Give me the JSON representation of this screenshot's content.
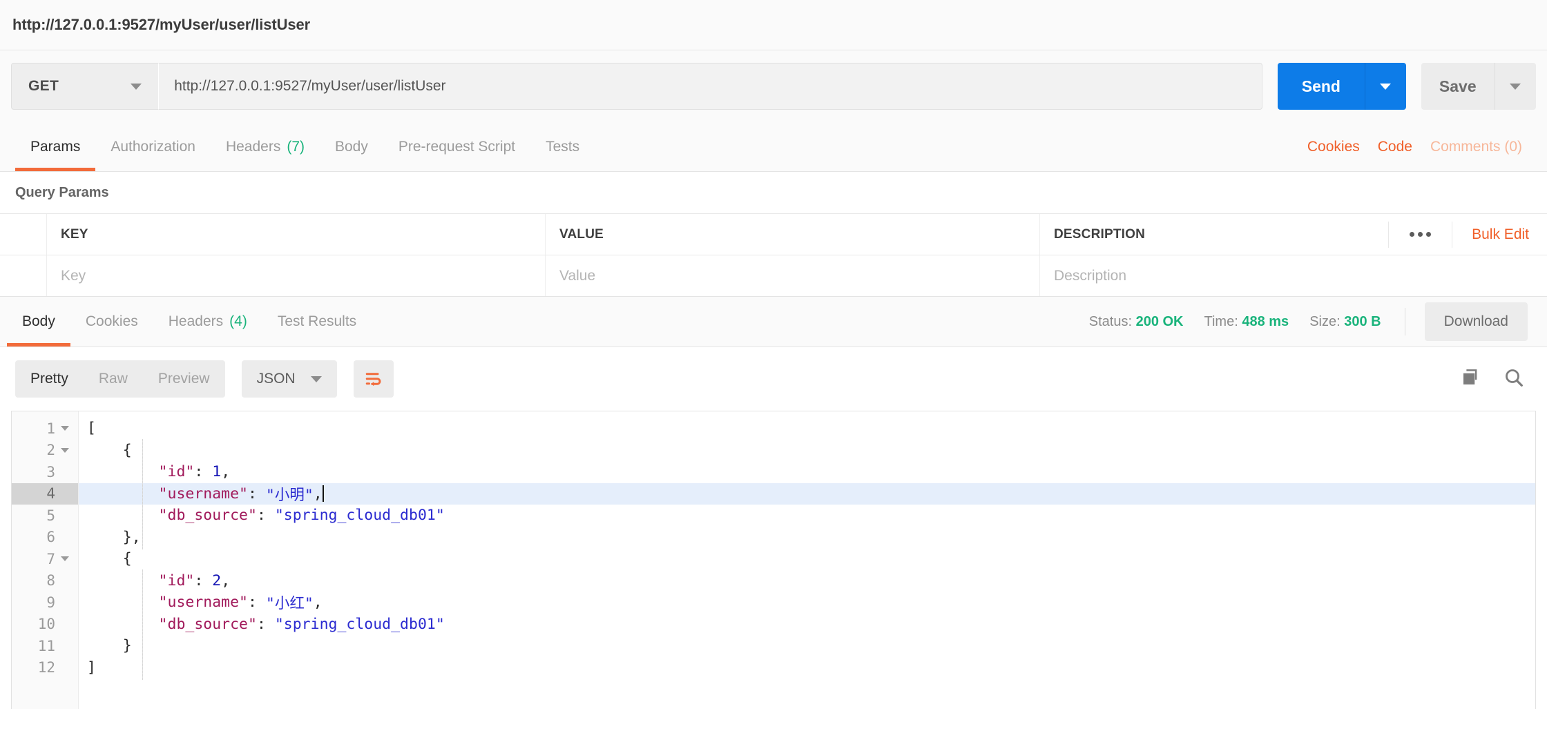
{
  "request_title": "http://127.0.0.1:9527/myUser/user/listUser",
  "url_bar": {
    "method": "GET",
    "url_value": "http://127.0.0.1:9527/myUser/user/listUser",
    "send_label": "Send",
    "save_label": "Save"
  },
  "request_tabs": {
    "items": [
      {
        "label": "Params",
        "badge": "",
        "active": true
      },
      {
        "label": "Authorization",
        "badge": "",
        "active": false
      },
      {
        "label": "Headers",
        "badge": "(7)",
        "active": false
      },
      {
        "label": "Body",
        "badge": "",
        "active": false
      },
      {
        "label": "Pre-request Script",
        "badge": "",
        "active": false
      },
      {
        "label": "Tests",
        "badge": "",
        "active": false
      }
    ],
    "cookies_label": "Cookies",
    "code_label": "Code",
    "comments_label": "Comments (0)"
  },
  "query_params": {
    "section_title": "Query Params",
    "columns": [
      "KEY",
      "VALUE",
      "DESCRIPTION"
    ],
    "placeholder_row": {
      "key": "Key",
      "value": "Value",
      "description": "Description"
    },
    "bulk_edit_label": "Bulk Edit"
  },
  "response_tabs": {
    "items": [
      {
        "label": "Body",
        "badge": "",
        "active": true
      },
      {
        "label": "Cookies",
        "badge": "",
        "active": false
      },
      {
        "label": "Headers",
        "badge": "(4)",
        "active": false
      },
      {
        "label": "Test Results",
        "badge": "",
        "active": false
      }
    ],
    "status_label": "Status:",
    "status_value": "200 OK",
    "time_label": "Time:",
    "time_value": "488 ms",
    "size_label": "Size:",
    "size_value": "300 B",
    "download_label": "Download"
  },
  "body_toolbar": {
    "views": [
      {
        "label": "Pretty",
        "active": true
      },
      {
        "label": "Raw",
        "active": false
      },
      {
        "label": "Preview",
        "active": false
      }
    ],
    "format": "JSON",
    "wrap_icon": "wrap-lines-icon",
    "copy_icon": "copy-icon",
    "search_icon": "search-icon"
  },
  "code_viewer": {
    "highlighted_line": 4,
    "lines": [
      {
        "n": 1,
        "fold": true,
        "tokens": [
          {
            "t": "p",
            "v": "["
          }
        ]
      },
      {
        "n": 2,
        "fold": true,
        "tokens": [
          {
            "t": "p",
            "v": "    {"
          }
        ]
      },
      {
        "n": 3,
        "fold": false,
        "tokens": [
          {
            "t": "k",
            "v": "        \"id\""
          },
          {
            "t": "p",
            "v": ": "
          },
          {
            "t": "n",
            "v": "1"
          },
          {
            "t": "p",
            "v": ","
          }
        ]
      },
      {
        "n": 4,
        "fold": false,
        "tokens": [
          {
            "t": "k",
            "v": "        \"username\""
          },
          {
            "t": "p",
            "v": ": "
          },
          {
            "t": "s",
            "v": "\"小明\""
          },
          {
            "t": "p",
            "v": ","
          }
        ],
        "cursor": true
      },
      {
        "n": 5,
        "fold": false,
        "tokens": [
          {
            "t": "k",
            "v": "        \"db_source\""
          },
          {
            "t": "p",
            "v": ": "
          },
          {
            "t": "s",
            "v": "\"spring_cloud_db01\""
          }
        ]
      },
      {
        "n": 6,
        "fold": false,
        "tokens": [
          {
            "t": "p",
            "v": "    },"
          }
        ]
      },
      {
        "n": 7,
        "fold": true,
        "tokens": [
          {
            "t": "p",
            "v": "    {"
          }
        ]
      },
      {
        "n": 8,
        "fold": false,
        "tokens": [
          {
            "t": "k",
            "v": "        \"id\""
          },
          {
            "t": "p",
            "v": ": "
          },
          {
            "t": "n",
            "v": "2"
          },
          {
            "t": "p",
            "v": ","
          }
        ]
      },
      {
        "n": 9,
        "fold": false,
        "tokens": [
          {
            "t": "k",
            "v": "        \"username\""
          },
          {
            "t": "p",
            "v": ": "
          },
          {
            "t": "s",
            "v": "\"小红\""
          },
          {
            "t": "p",
            "v": ","
          }
        ]
      },
      {
        "n": 10,
        "fold": false,
        "tokens": [
          {
            "t": "k",
            "v": "        \"db_source\""
          },
          {
            "t": "p",
            "v": ": "
          },
          {
            "t": "s",
            "v": "\"spring_cloud_db01\""
          }
        ]
      },
      {
        "n": 11,
        "fold": false,
        "tokens": [
          {
            "t": "p",
            "v": "    }"
          }
        ]
      },
      {
        "n": 12,
        "fold": false,
        "tokens": [
          {
            "t": "p",
            "v": "]"
          }
        ]
      }
    ]
  },
  "colors": {
    "accent_orange": "#f05f29",
    "send_blue": "#0d7ce8",
    "status_green": "#19b37b"
  }
}
